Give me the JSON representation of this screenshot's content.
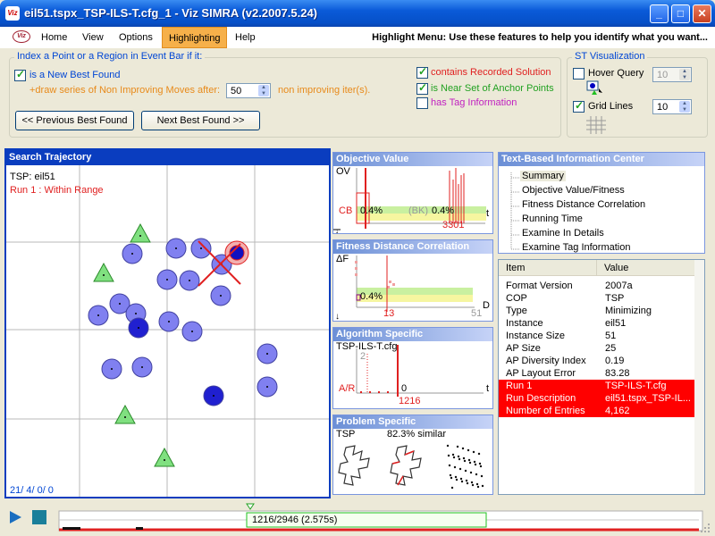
{
  "window": {
    "title": "eil51.tspx_TSP-ILS-T.cfg_1 - Viz SIMRA (v2.2007.5.24)",
    "icon": "viz-app-icon",
    "min": "_",
    "max": "□",
    "close": "✕"
  },
  "menu": {
    "logo": "Viz",
    "items": [
      "Home",
      "View",
      "Options",
      "Highlighting",
      "Help"
    ],
    "hint": "Highlight Menu: Use these features to help you identify what you want..."
  },
  "index_group": {
    "legend": "Index a Point or a Region in Event Bar if it:",
    "new_best": "is a New Best Found",
    "draw_series": "+draw series of Non Improving Moves after:",
    "iter_value": "50",
    "iter_suffix": "non improving iter(s).",
    "prev_btn": "<< Previous Best Found",
    "next_btn": "Next Best Found >>",
    "contains": "contains Recorded Solution",
    "near_set": "is Near Set of Anchor Points",
    "tag_info": "has Tag Information"
  },
  "st_group": {
    "legend": "ST Visualization",
    "hover": "Hover Query",
    "hover_value": "10",
    "grid": "Grid Lines",
    "grid_value": "10"
  },
  "trajectory": {
    "title": "Search Trajectory",
    "problem": "TSP: eil51",
    "run": "Run 1 : Within Range",
    "counter": "21/ 4/ 0/ 0"
  },
  "objective": {
    "title": "Objective Value",
    "ov": "OV",
    "cb": "CB",
    "pct1": "0.4%",
    "bk": "(BK)",
    "pct2": "0.4%",
    "xval": "3301",
    "t": "t"
  },
  "fdc": {
    "title": "Fitness Distance Correlation",
    "df": "ΔF",
    "pct": "0.4%",
    "x1": "13",
    "x2": "51",
    "d": "D"
  },
  "algo": {
    "title": "Algorithm Specific",
    "cfg": "TSP-ILS-T.cfg",
    "ar": "A/R",
    "two": "2",
    "zero": "0",
    "t": "t",
    "x": "1216"
  },
  "problem": {
    "title": "Problem Specific",
    "label": "TSP",
    "similar": "82.3% similar"
  },
  "info": {
    "title": "Text-Based Information Center",
    "tree": [
      "Summary",
      "Objective Value/Fitness",
      "Fitness Distance Correlation",
      "Running Time",
      "Examine In Details",
      "Examine Tag Information"
    ],
    "col_item": "Item",
    "col_value": "Value",
    "rows": [
      [
        "Format Version",
        "2007a"
      ],
      [
        "COP",
        "TSP"
      ],
      [
        "Type",
        "Minimizing"
      ],
      [
        "Instance",
        "eil51"
      ],
      [
        "Instance Size",
        "51"
      ],
      [
        "AP Size",
        "25"
      ],
      [
        "AP Diversity Index",
        "0.19"
      ],
      [
        "AP Layout Error",
        "83.28"
      ],
      [
        "Run 1",
        "TSP-ILS-T.cfg"
      ],
      [
        "Run Description",
        "eil51.tspx_TSP-IL..."
      ],
      [
        "Number of Entries",
        "4,162"
      ]
    ]
  },
  "playback": {
    "status": "1216/2946 (2.575s)"
  }
}
